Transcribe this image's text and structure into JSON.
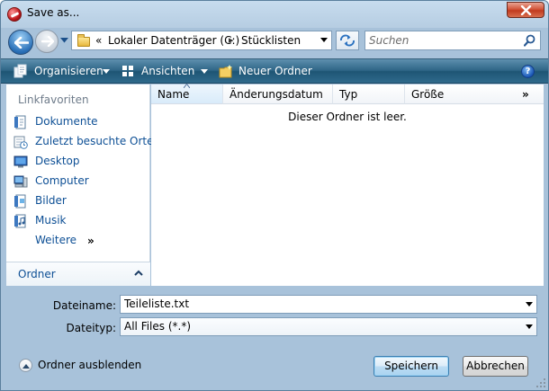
{
  "window": {
    "title": "Save as..."
  },
  "navigation": {
    "breadcrumb": [
      "Lokaler Datenträger (C:)",
      "Stücklisten"
    ],
    "overflow_chevron": "«",
    "separator": "▸",
    "search_placeholder": "Suchen"
  },
  "toolbar": {
    "organize": "Organisieren",
    "views": "Ansichten",
    "new_folder": "Neuer Ordner",
    "help": "?"
  },
  "sidebar": {
    "heading": "Linkfavoriten",
    "items": [
      {
        "label": "Dokumente",
        "icon": "documents-icon"
      },
      {
        "label": "Zuletzt besuchte Orte",
        "icon": "recent-places-icon"
      },
      {
        "label": "Desktop",
        "icon": "desktop-icon"
      },
      {
        "label": "Computer",
        "icon": "computer-icon"
      },
      {
        "label": "Bilder",
        "icon": "pictures-icon"
      },
      {
        "label": "Musik",
        "icon": "music-icon"
      }
    ],
    "more": "Weitere",
    "more_chevron": "»",
    "folders": "Ordner"
  },
  "file_list": {
    "columns": [
      "Name",
      "Änderungsdatum",
      "Typ",
      "Größe"
    ],
    "more_columns": "»",
    "empty_message": "Dieser Ordner ist leer."
  },
  "form": {
    "filename_label": "Dateiname:",
    "filename_value": "Teileliste.txt",
    "filetype_label": "Dateityp:",
    "filetype_value": "All Files (*.*)"
  },
  "footer": {
    "hide_folders": "Ordner ausblenden",
    "save": "Speichern",
    "cancel": "Abbrechen"
  },
  "colors": {
    "toolbar": "#2e6586",
    "link": "#0d4f95",
    "close": "#c13b1f"
  }
}
